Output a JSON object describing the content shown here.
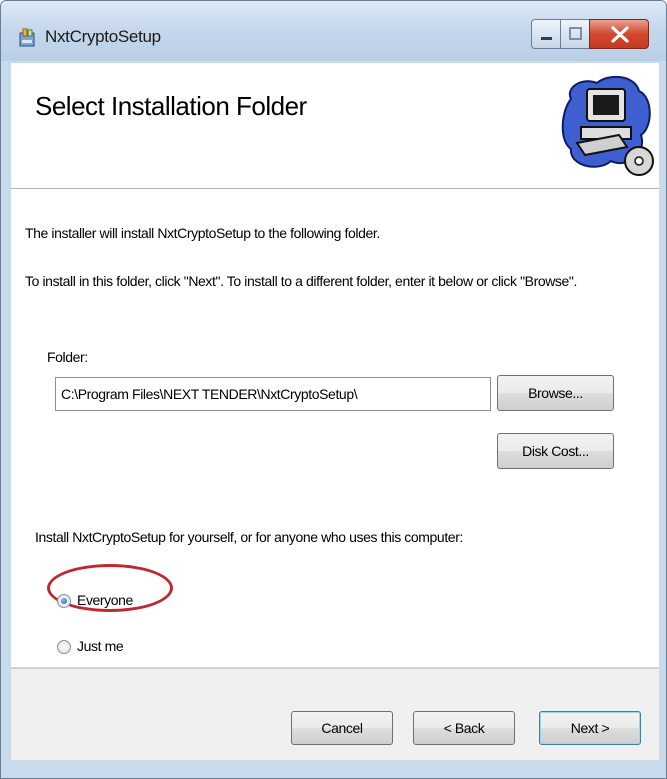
{
  "window": {
    "title": "NxtCryptoSetup",
    "icon": "installer-package-icon",
    "controls": [
      "minimize-icon",
      "maximize-icon",
      "close-icon"
    ]
  },
  "banner": {
    "title": "Select Installation Folder",
    "art": "computer-with-cd-icon"
  },
  "body": {
    "intro": "The installer will install NxtCryptoSetup to the following folder.",
    "instructions": "To install in this folder, click \"Next\". To install to a different folder, enter it below or click \"Browse\".",
    "folder_label": "Folder:",
    "folder_value": "C:\\Program Files\\NEXT TENDER\\NxtCryptoSetup\\",
    "browse_label": "Browse...",
    "disk_cost_label": "Disk Cost...",
    "scope_question": "Install NxtCryptoSetup for yourself, or for anyone who uses this computer:",
    "options": [
      {
        "label": "Everyone",
        "selected": true
      },
      {
        "label": "Just me",
        "selected": false
      }
    ]
  },
  "footer": {
    "cancel_label": "Cancel",
    "back_label": "< Back",
    "next_label": "Next >"
  },
  "colors": {
    "highlight_ring": "#c0282e",
    "close_button": "#c23b22",
    "frame": "#c9daea"
  }
}
